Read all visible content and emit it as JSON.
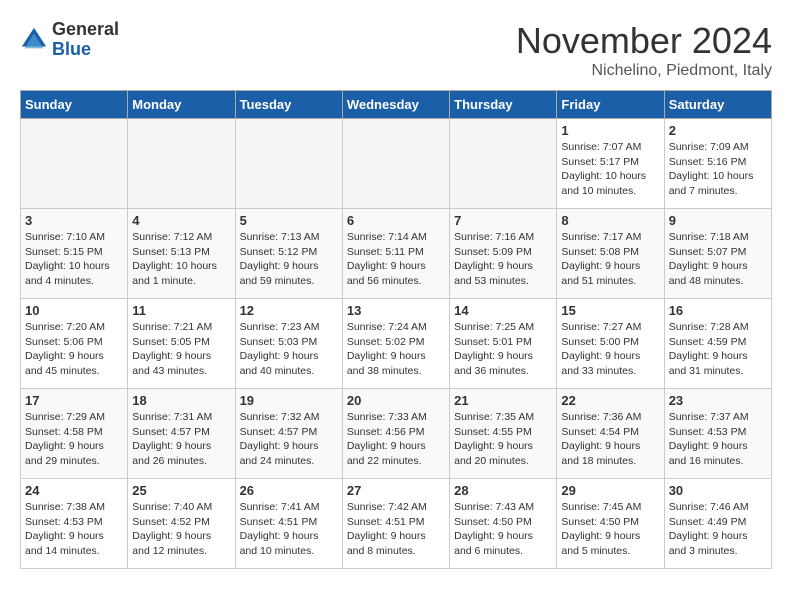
{
  "header": {
    "logo_general": "General",
    "logo_blue": "Blue",
    "month": "November 2024",
    "location": "Nichelino, Piedmont, Italy"
  },
  "days_of_week": [
    "Sunday",
    "Monday",
    "Tuesday",
    "Wednesday",
    "Thursday",
    "Friday",
    "Saturday"
  ],
  "weeks": [
    [
      {
        "day": "",
        "empty": true
      },
      {
        "day": "",
        "empty": true
      },
      {
        "day": "",
        "empty": true
      },
      {
        "day": "",
        "empty": true
      },
      {
        "day": "",
        "empty": true
      },
      {
        "day": "1",
        "sunrise": "Sunrise: 7:07 AM",
        "sunset": "Sunset: 5:17 PM",
        "daylight": "Daylight: 10 hours and 10 minutes."
      },
      {
        "day": "2",
        "sunrise": "Sunrise: 7:09 AM",
        "sunset": "Sunset: 5:16 PM",
        "daylight": "Daylight: 10 hours and 7 minutes."
      }
    ],
    [
      {
        "day": "3",
        "sunrise": "Sunrise: 7:10 AM",
        "sunset": "Sunset: 5:15 PM",
        "daylight": "Daylight: 10 hours and 4 minutes."
      },
      {
        "day": "4",
        "sunrise": "Sunrise: 7:12 AM",
        "sunset": "Sunset: 5:13 PM",
        "daylight": "Daylight: 10 hours and 1 minute."
      },
      {
        "day": "5",
        "sunrise": "Sunrise: 7:13 AM",
        "sunset": "Sunset: 5:12 PM",
        "daylight": "Daylight: 9 hours and 59 minutes."
      },
      {
        "day": "6",
        "sunrise": "Sunrise: 7:14 AM",
        "sunset": "Sunset: 5:11 PM",
        "daylight": "Daylight: 9 hours and 56 minutes."
      },
      {
        "day": "7",
        "sunrise": "Sunrise: 7:16 AM",
        "sunset": "Sunset: 5:09 PM",
        "daylight": "Daylight: 9 hours and 53 minutes."
      },
      {
        "day": "8",
        "sunrise": "Sunrise: 7:17 AM",
        "sunset": "Sunset: 5:08 PM",
        "daylight": "Daylight: 9 hours and 51 minutes."
      },
      {
        "day": "9",
        "sunrise": "Sunrise: 7:18 AM",
        "sunset": "Sunset: 5:07 PM",
        "daylight": "Daylight: 9 hours and 48 minutes."
      }
    ],
    [
      {
        "day": "10",
        "sunrise": "Sunrise: 7:20 AM",
        "sunset": "Sunset: 5:06 PM",
        "daylight": "Daylight: 9 hours and 45 minutes."
      },
      {
        "day": "11",
        "sunrise": "Sunrise: 7:21 AM",
        "sunset": "Sunset: 5:05 PM",
        "daylight": "Daylight: 9 hours and 43 minutes."
      },
      {
        "day": "12",
        "sunrise": "Sunrise: 7:23 AM",
        "sunset": "Sunset: 5:03 PM",
        "daylight": "Daylight: 9 hours and 40 minutes."
      },
      {
        "day": "13",
        "sunrise": "Sunrise: 7:24 AM",
        "sunset": "Sunset: 5:02 PM",
        "daylight": "Daylight: 9 hours and 38 minutes."
      },
      {
        "day": "14",
        "sunrise": "Sunrise: 7:25 AM",
        "sunset": "Sunset: 5:01 PM",
        "daylight": "Daylight: 9 hours and 36 minutes."
      },
      {
        "day": "15",
        "sunrise": "Sunrise: 7:27 AM",
        "sunset": "Sunset: 5:00 PM",
        "daylight": "Daylight: 9 hours and 33 minutes."
      },
      {
        "day": "16",
        "sunrise": "Sunrise: 7:28 AM",
        "sunset": "Sunset: 4:59 PM",
        "daylight": "Daylight: 9 hours and 31 minutes."
      }
    ],
    [
      {
        "day": "17",
        "sunrise": "Sunrise: 7:29 AM",
        "sunset": "Sunset: 4:58 PM",
        "daylight": "Daylight: 9 hours and 29 minutes."
      },
      {
        "day": "18",
        "sunrise": "Sunrise: 7:31 AM",
        "sunset": "Sunset: 4:57 PM",
        "daylight": "Daylight: 9 hours and 26 minutes."
      },
      {
        "day": "19",
        "sunrise": "Sunrise: 7:32 AM",
        "sunset": "Sunset: 4:57 PM",
        "daylight": "Daylight: 9 hours and 24 minutes."
      },
      {
        "day": "20",
        "sunrise": "Sunrise: 7:33 AM",
        "sunset": "Sunset: 4:56 PM",
        "daylight": "Daylight: 9 hours and 22 minutes."
      },
      {
        "day": "21",
        "sunrise": "Sunrise: 7:35 AM",
        "sunset": "Sunset: 4:55 PM",
        "daylight": "Daylight: 9 hours and 20 minutes."
      },
      {
        "day": "22",
        "sunrise": "Sunrise: 7:36 AM",
        "sunset": "Sunset: 4:54 PM",
        "daylight": "Daylight: 9 hours and 18 minutes."
      },
      {
        "day": "23",
        "sunrise": "Sunrise: 7:37 AM",
        "sunset": "Sunset: 4:53 PM",
        "daylight": "Daylight: 9 hours and 16 minutes."
      }
    ],
    [
      {
        "day": "24",
        "sunrise": "Sunrise: 7:38 AM",
        "sunset": "Sunset: 4:53 PM",
        "daylight": "Daylight: 9 hours and 14 minutes."
      },
      {
        "day": "25",
        "sunrise": "Sunrise: 7:40 AM",
        "sunset": "Sunset: 4:52 PM",
        "daylight": "Daylight: 9 hours and 12 minutes."
      },
      {
        "day": "26",
        "sunrise": "Sunrise: 7:41 AM",
        "sunset": "Sunset: 4:51 PM",
        "daylight": "Daylight: 9 hours and 10 minutes."
      },
      {
        "day": "27",
        "sunrise": "Sunrise: 7:42 AM",
        "sunset": "Sunset: 4:51 PM",
        "daylight": "Daylight: 9 hours and 8 minutes."
      },
      {
        "day": "28",
        "sunrise": "Sunrise: 7:43 AM",
        "sunset": "Sunset: 4:50 PM",
        "daylight": "Daylight: 9 hours and 6 minutes."
      },
      {
        "day": "29",
        "sunrise": "Sunrise: 7:45 AM",
        "sunset": "Sunset: 4:50 PM",
        "daylight": "Daylight: 9 hours and 5 minutes."
      },
      {
        "day": "30",
        "sunrise": "Sunrise: 7:46 AM",
        "sunset": "Sunset: 4:49 PM",
        "daylight": "Daylight: 9 hours and 3 minutes."
      }
    ]
  ]
}
